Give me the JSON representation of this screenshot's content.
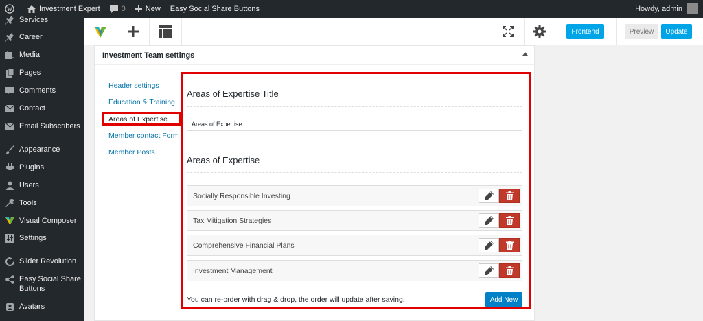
{
  "adminbar": {
    "site_name": "Investment Expert",
    "comments_count": "0",
    "new_label": "New",
    "plugin_label": "Easy Social Share Buttons",
    "greeting": "Howdy, admin"
  },
  "sidebar": {
    "items": [
      {
        "label": "Services",
        "icon": "pin-icon"
      },
      {
        "label": "Career",
        "icon": "pin-icon"
      },
      {
        "label": "Media",
        "icon": "media-icon"
      },
      {
        "label": "Pages",
        "icon": "pages-icon"
      },
      {
        "label": "Comments",
        "icon": "comments-icon"
      },
      {
        "label": "Contact",
        "icon": "mail-icon"
      },
      {
        "label": "Email Subscribers",
        "icon": "mail-icon"
      },
      {
        "label": "Appearance",
        "icon": "paintbrush-icon"
      },
      {
        "label": "Plugins",
        "icon": "plugin-icon"
      },
      {
        "label": "Users",
        "icon": "users-icon"
      },
      {
        "label": "Tools",
        "icon": "wrench-icon"
      },
      {
        "label": "Visual Composer",
        "icon": "vc-logo-icon"
      },
      {
        "label": "Settings",
        "icon": "settings-icon"
      },
      {
        "label": "Slider Revolution",
        "icon": "refresh-icon"
      },
      {
        "label": "Easy Social Share Buttons",
        "icon": "share-icon"
      },
      {
        "label": "Avatars",
        "icon": "avatar-icon"
      }
    ]
  },
  "toolbar": {
    "frontend_label": "Frontend",
    "preview_label": "Preview",
    "update_label": "Update"
  },
  "metabox": {
    "title": "Investment Team settings",
    "tabs": [
      {
        "label": "Header settings"
      },
      {
        "label": "Education & Training"
      },
      {
        "label": "Areas of Expertise"
      },
      {
        "label": "Member contact Form"
      },
      {
        "label": "Member Posts"
      }
    ],
    "title_section_heading": "Areas of Expertise Title",
    "title_input_value": "Areas of Expertise",
    "list_heading": "Areas of Expertise",
    "items": [
      {
        "label": "Socially Responsible Investing"
      },
      {
        "label": "Tax Mitigation Strategies"
      },
      {
        "label": "Comprehensive Financial Plans"
      },
      {
        "label": "Investment Management"
      }
    ],
    "hint": "You can re-order with drag & drop, the order will update after saving.",
    "add_new_label": "Add New"
  },
  "colors": {
    "adminbar_bg": "#23282d",
    "accent_blue": "#00a5e8",
    "delete_red": "#c0392b",
    "highlight_red": "#e00000",
    "link_blue": "#0073aa"
  }
}
